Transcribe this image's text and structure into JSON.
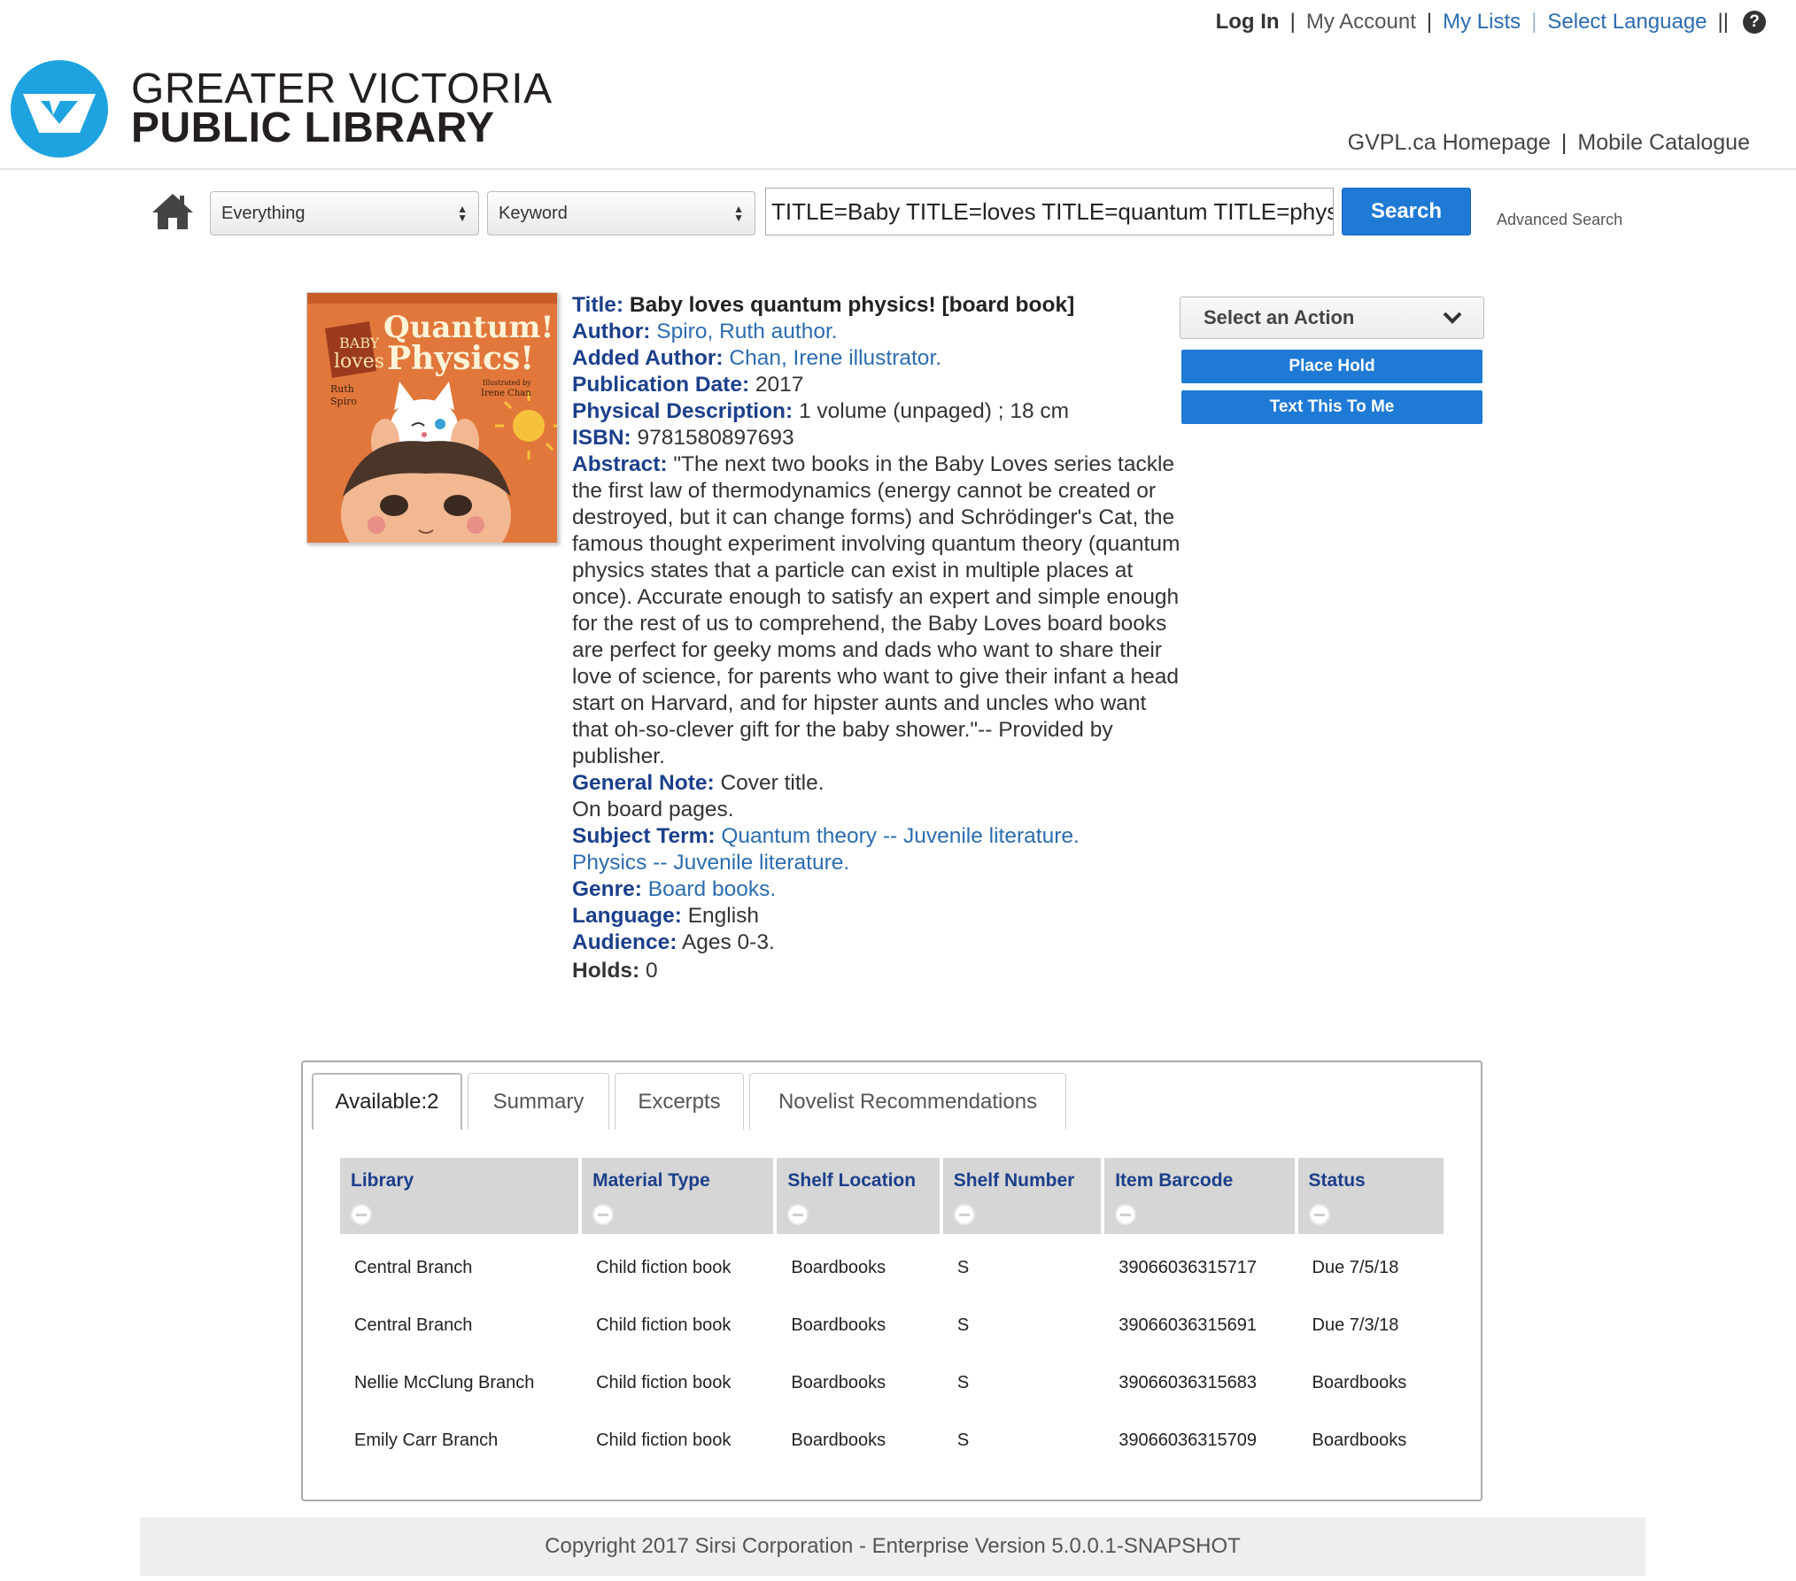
{
  "top_nav": {
    "login": "Log In",
    "my_account": "My Account",
    "my_lists": "My Lists",
    "select_language": "Select Language",
    "trailing_sep": "||",
    "help_glyph": "?"
  },
  "logo": {
    "line1": "GREATER VICTORIA",
    "line2": "PUBLIC LIBRARY",
    "brand_color": "#1ea3e0"
  },
  "header_links": {
    "homepage": "GVPL.ca Homepage",
    "mobile": "Mobile Catalogue"
  },
  "search": {
    "scope": "Everything",
    "field": "Keyword",
    "query": "TITLE=Baby TITLE=loves TITLE=quantum TITLE=physics! AUTHOR=Spiro",
    "button": "Search",
    "advanced": "Advanced Search"
  },
  "cover": {
    "title_line1": "Quantum!",
    "title_line2": "Physics!",
    "series_baby": "BABY",
    "series_loves": "loves",
    "author_first": "Ruth",
    "author_last": "Spiro",
    "illustrated_by": "Illustrated by",
    "illustrator": "Irene Chan"
  },
  "record": {
    "title_label": "Title:",
    "title": "Baby loves quantum physics! [board book]",
    "author_label": "Author:",
    "author": "Spiro, Ruth author.",
    "added_author_label": "Added Author:",
    "added_author": "Chan, Irene illustrator.",
    "pub_date_label": "Publication Date:",
    "pub_date": "2017",
    "phys_desc_label": "Physical Description:",
    "phys_desc": "1 volume (unpaged) ; 18 cm",
    "isbn_label": "ISBN:",
    "isbn": "9781580897693",
    "abstract_label": "Abstract:",
    "abstract": "\"The next two books in the Baby Loves series tackle the first law of thermodynamics (energy cannot be created or destroyed, but it can change forms) and Schrödinger's Cat, the famous thought experiment involving quantum theory (quantum physics states that a particle can exist in multiple places at once). Accurate enough to satisfy an expert and simple enough for the rest of us to comprehend, the Baby Loves board books are perfect for geeky moms and dads who want to share their love of science, for parents who want to give their infant a head start on Harvard, and for hipster aunts and uncles who want that oh-so-clever gift for the baby shower.\"-- Provided by publisher.",
    "general_note_label": "General Note:",
    "general_note_1": "Cover title.",
    "general_note_2": "On board pages.",
    "subject_label": "Subject Term:",
    "subject_1": "Quantum theory -- Juvenile literature.",
    "subject_2": "Physics -- Juvenile literature.",
    "genre_label": "Genre:",
    "genre": "Board books.",
    "language_label": "Language:",
    "language": "English",
    "audience_label": "Audience:",
    "audience": "Ages 0-3.",
    "holds_label": "Holds:",
    "holds": "0"
  },
  "actions": {
    "select": "Select an Action",
    "place_hold": "Place Hold",
    "text_me": "Text This To Me"
  },
  "tabs": [
    "Available:2",
    "Summary",
    "Excerpts",
    "Novelist Recommendations"
  ],
  "table": {
    "headers": [
      "Library",
      "Material Type",
      "Shelf Location",
      "Shelf Number",
      "Item Barcode",
      "Status"
    ],
    "rows": [
      [
        "Central Branch",
        "Child fiction book",
        "Boardbooks",
        "S",
        "39066036315717",
        "Due 7/5/18"
      ],
      [
        "Central Branch",
        "Child fiction book",
        "Boardbooks",
        "S",
        "39066036315691",
        "Due 7/3/18"
      ],
      [
        "Nellie McClung Branch",
        "Child fiction book",
        "Boardbooks",
        "S",
        "39066036315683",
        "Boardbooks"
      ],
      [
        "Emily Carr Branch",
        "Child fiction book",
        "Boardbooks",
        "S",
        "39066036315709",
        "Boardbooks"
      ]
    ]
  },
  "footer": {
    "copyright": "Copyright 2017 Sirsi Corporation - Enterprise Version 5.0.0.1-SNAPSHOT"
  },
  "colors": {
    "accent_blue": "#1f7ad6",
    "label_navy": "#1b3f8b",
    "link_blue": "#2b6cb0"
  }
}
